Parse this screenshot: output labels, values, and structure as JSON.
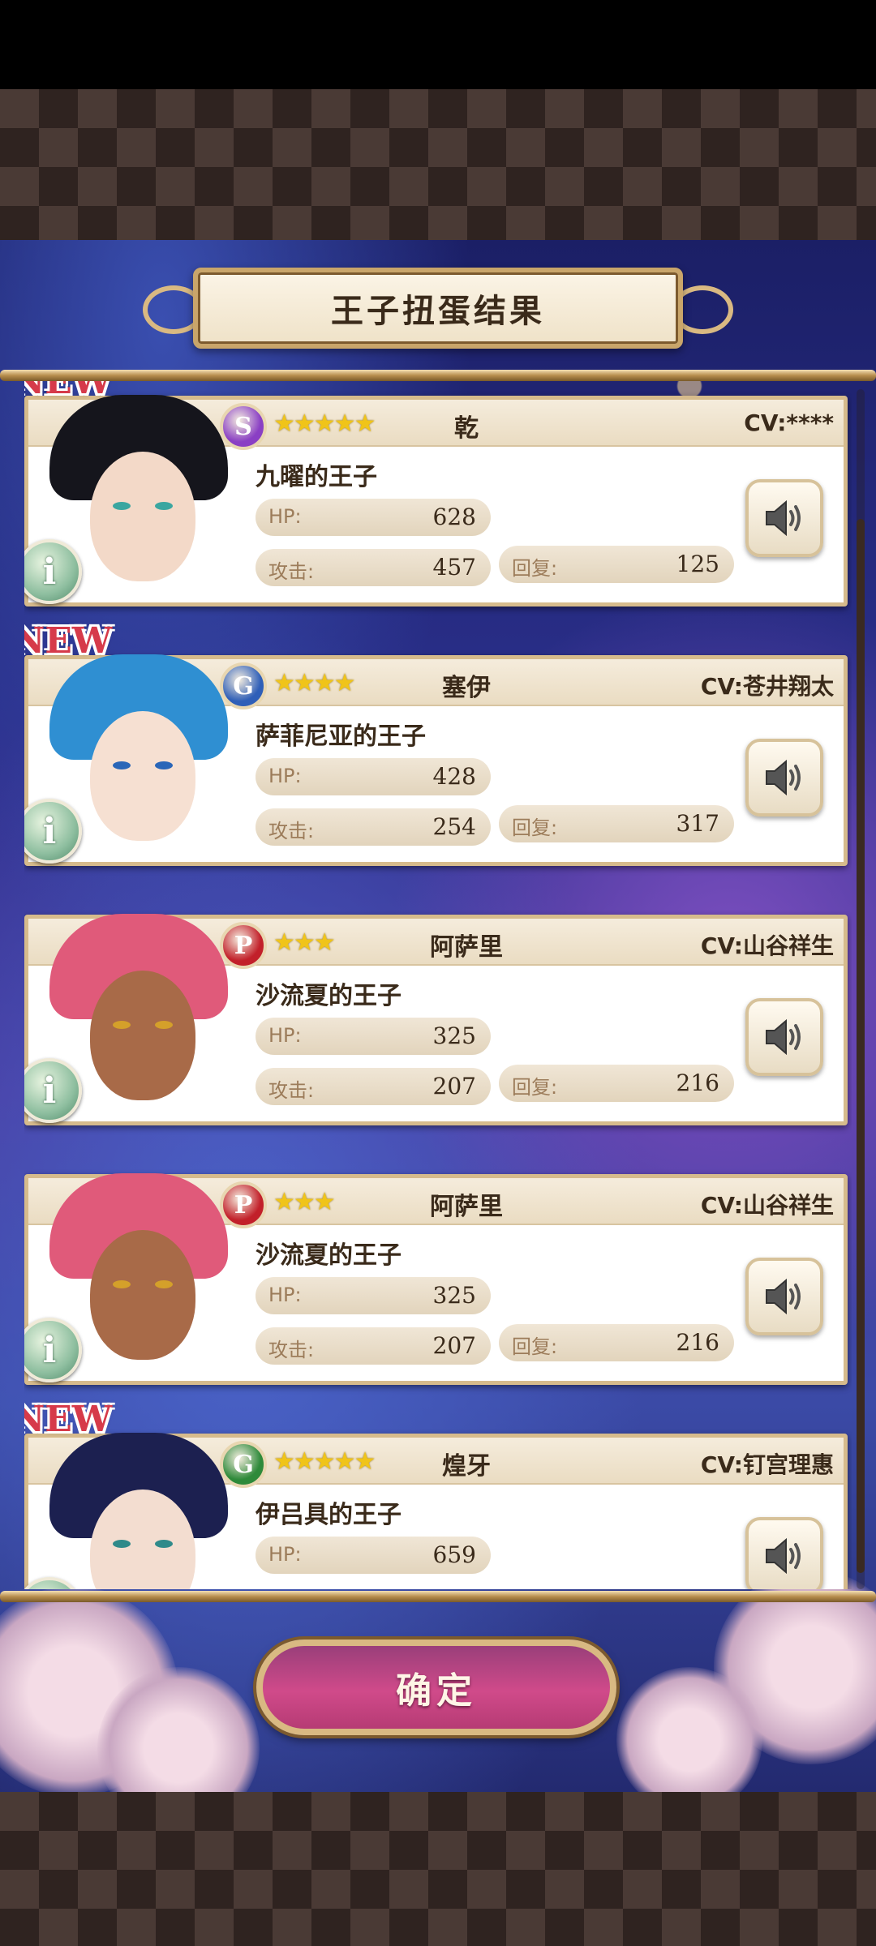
{
  "header": {
    "title": "王子扭蛋结果"
  },
  "labels": {
    "hp": "HP:",
    "attack": "攻击:",
    "recovery": "回复:"
  },
  "new_label": "NEW",
  "cards": [
    {
      "is_new": true,
      "rarity_letter": "S",
      "rarity_color": "#8a3fc4",
      "stars": "★★★★★",
      "name": "乾",
      "cv": "CV:****",
      "title": "九曜的王子",
      "hp": "628",
      "attack": "457",
      "recovery": "125"
    },
    {
      "is_new": true,
      "rarity_letter": "G",
      "rarity_color": "#2f5fb8",
      "stars": "★★★★",
      "name": "塞伊",
      "cv": "CV:苍井翔太",
      "title": "萨菲尼亚的王子",
      "hp": "428",
      "attack": "254",
      "recovery": "317"
    },
    {
      "is_new": false,
      "rarity_letter": "P",
      "rarity_color": "#c2202a",
      "stars": "★★★",
      "name": "阿萨里",
      "cv": "CV:山谷祥生",
      "title": "沙流夏的王子",
      "hp": "325",
      "attack": "207",
      "recovery": "216"
    },
    {
      "is_new": false,
      "rarity_letter": "P",
      "rarity_color": "#c2202a",
      "stars": "★★★",
      "name": "阿萨里",
      "cv": "CV:山谷祥生",
      "title": "沙流夏的王子",
      "hp": "325",
      "attack": "207",
      "recovery": "216"
    },
    {
      "is_new": true,
      "rarity_letter": "G",
      "rarity_color": "#2e8a3a",
      "stars": "★★★★★",
      "name": "煌牙",
      "cv": "CV:钉宫理惠",
      "title": "伊吕具的王子",
      "hp": "659",
      "attack": "",
      "recovery": ""
    }
  ],
  "confirm_button": {
    "label": "确定"
  }
}
